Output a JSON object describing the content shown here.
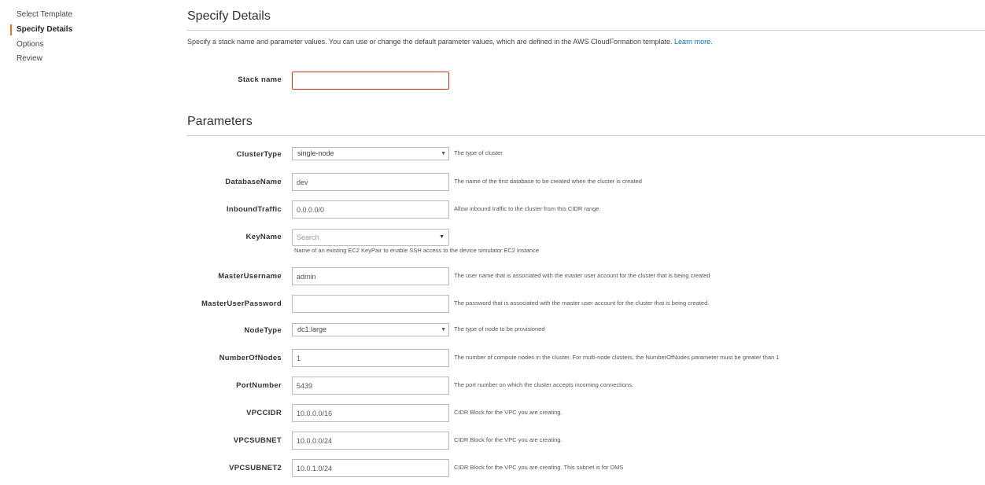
{
  "sidebar": {
    "steps": [
      {
        "label": "Select Template"
      },
      {
        "label": "Specify Details"
      },
      {
        "label": "Options"
      },
      {
        "label": "Review"
      }
    ],
    "accent_color": "#ec7211"
  },
  "details": {
    "title": "Specify Details",
    "intro": "Specify a stack name and parameter values. You can use or change the default parameter values, which are defined in the AWS CloudFormation template.",
    "learn_more": "Learn more.",
    "stack_name_label": "Stack name",
    "stack_name_value": ""
  },
  "parameters": {
    "title": "Parameters",
    "cluster_type": {
      "label": "ClusterType",
      "value": "single-node",
      "hint": "The type of cluster"
    },
    "database_name": {
      "label": "DatabaseName",
      "value": "dev",
      "hint": "The name of the first database to be created when the cluster is created"
    },
    "inbound_traffic": {
      "label": "InboundTraffic",
      "value": "0.0.0.0/0",
      "hint": "Allow inbound traffic to the cluster from this CIDR range."
    },
    "key_name": {
      "label": "KeyName",
      "placeholder": "Search",
      "hint": "Name of an existing EC2 KeyPair to enable SSH access to the device simulator EC2 instance"
    },
    "master_username": {
      "label": "MasterUsername",
      "value": "admin",
      "hint": "The user name that is associated with the master user account for the cluster that is being created"
    },
    "master_user_password": {
      "label": "MasterUserPassword",
      "value": "",
      "hint": "The password that is associated with the master user account for the cluster that is being created."
    },
    "node_type": {
      "label": "NodeType",
      "value": "dc1.large",
      "hint": "The type of node to be provisioned"
    },
    "number_of_nodes": {
      "label": "NumberOfNodes",
      "value": "1",
      "hint": "The number of compute nodes in the cluster. For multi-node clusters, the NumberOfNodes parameter must be greater than 1"
    },
    "port_number": {
      "label": "PortNumber",
      "value": "5439",
      "hint": "The port number on which the cluster accepts incoming connections."
    },
    "vpc_cidr": {
      "label": "VPCCIDR",
      "value": "10.0.0.0/16",
      "hint": "CIDR Block for the VPC you are creating."
    },
    "vpc_subnet": {
      "label": "VPCSUBNET",
      "value": "10.0.0.0/24",
      "hint": "CIDR Block for the VPC you are creating."
    },
    "vpc_subnet2": {
      "label": "VPCSUBNET2",
      "value": "10.0.1.0/24",
      "hint": "CIDR Block for the VPC you are creating. This subnet is for DMS"
    }
  }
}
